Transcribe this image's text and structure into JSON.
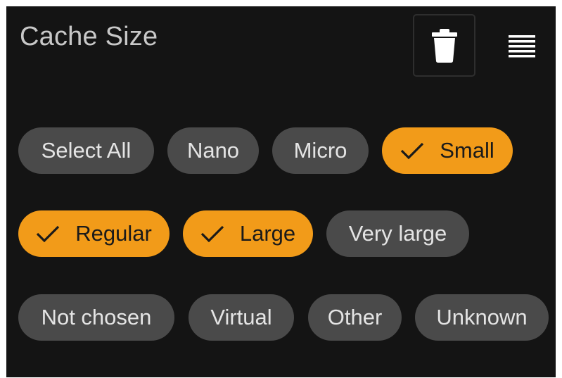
{
  "header": {
    "title": "Cache Size",
    "delete_icon": "trash-icon",
    "menu_icon": "list-menu-icon"
  },
  "colors": {
    "background": "#141414",
    "chip": "#4a4a4a",
    "chip_selected": "#f29b19",
    "chip_text": "#e4e4e4",
    "chip_selected_text": "#1a1a1a"
  },
  "chips": [
    {
      "label": "Select All",
      "selected": false
    },
    {
      "label": "Nano",
      "selected": false
    },
    {
      "label": "Micro",
      "selected": false
    },
    {
      "label": "Small",
      "selected": true
    },
    {
      "label": "Regular",
      "selected": true
    },
    {
      "label": "Large",
      "selected": true
    },
    {
      "label": "Very large",
      "selected": false
    },
    {
      "label": "Not chosen",
      "selected": false
    },
    {
      "label": "Virtual",
      "selected": false
    },
    {
      "label": "Other",
      "selected": false
    },
    {
      "label": "Unknown",
      "selected": false
    }
  ]
}
